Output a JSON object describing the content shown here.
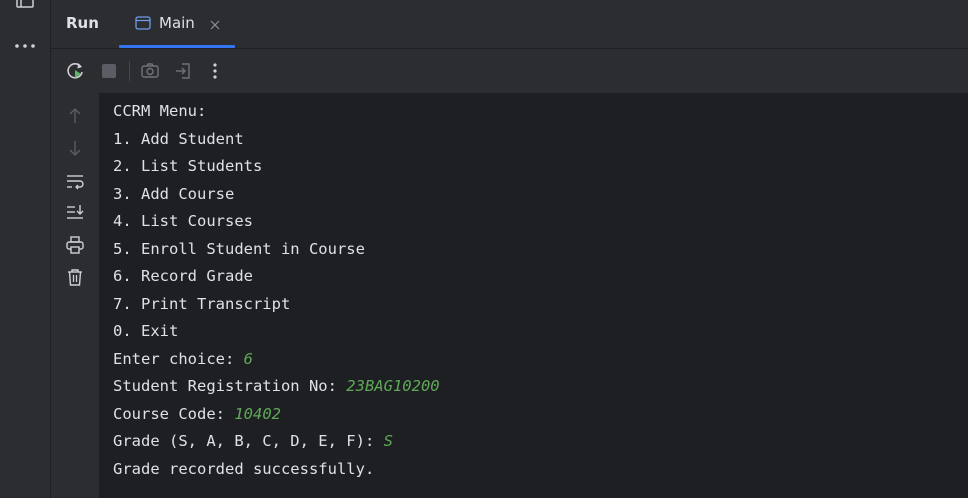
{
  "header": {
    "title": "Run",
    "tab": {
      "label": "Main"
    }
  },
  "console": {
    "lines": [
      {
        "text": "CCRM Menu:"
      },
      {
        "text": "1. Add Student"
      },
      {
        "text": "2. List Students"
      },
      {
        "text": "3. Add Course"
      },
      {
        "text": "4. List Courses"
      },
      {
        "text": "5. Enroll Student in Course"
      },
      {
        "text": "6. Record Grade"
      },
      {
        "text": "7. Print Transcript"
      },
      {
        "text": "0. Exit"
      },
      {
        "text": "Enter choice: ",
        "input": "6"
      },
      {
        "text": "Student Registration No: ",
        "input": "23BAG10200"
      },
      {
        "text": "Course Code: ",
        "input": "10402"
      },
      {
        "text": "Grade (S, A, B, C, D, E, F): ",
        "input": "S"
      },
      {
        "text": "Grade recorded successfully."
      }
    ]
  },
  "colors": {
    "background": "#1e1f22",
    "panel": "#2b2d30",
    "text": "#dfe1e5",
    "user_input": "#5fa858",
    "tab_underline": "#3574f0",
    "rerun_green": "#5fb865"
  },
  "icons": {
    "activity": [
      "project-icon",
      "more-icon"
    ],
    "tab": [
      "console-icon",
      "close-icon"
    ],
    "toolbar": [
      "rerun-icon",
      "stop-icon",
      "screenshot-icon",
      "exit-icon",
      "options-icon"
    ],
    "gutter": [
      "scroll-up-icon",
      "scroll-down-icon",
      "soft-wrap-icon",
      "scroll-to-end-icon",
      "print-icon",
      "clear-icon"
    ]
  }
}
